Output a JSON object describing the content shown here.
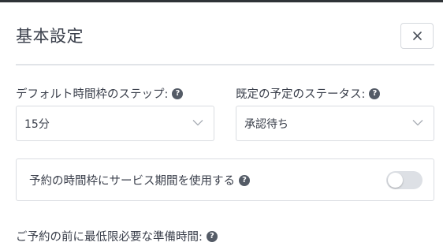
{
  "dialog": {
    "title": "基本設定",
    "close_icon": "close-icon"
  },
  "fields": {
    "default_slot_step": {
      "label": "デフォルト時間枠のステップ:",
      "value": "15分",
      "help_glyph": "?"
    },
    "default_status": {
      "label": "既定の予定のステータス:",
      "value": "承認待ち",
      "help_glyph": "?"
    },
    "service_duration_toggle": {
      "label": "予約の時間枠にサービス期間を使用する",
      "help_glyph": "?",
      "enabled": false
    },
    "min_prep_time": {
      "label": "ご予約の前に最低限必要な準備時間:",
      "help_glyph": "?"
    }
  },
  "colors": {
    "text": "#3a3f4b",
    "border": "#d9dce1",
    "help_bg": "#545b66",
    "toggle_off": "#dde0e5"
  }
}
